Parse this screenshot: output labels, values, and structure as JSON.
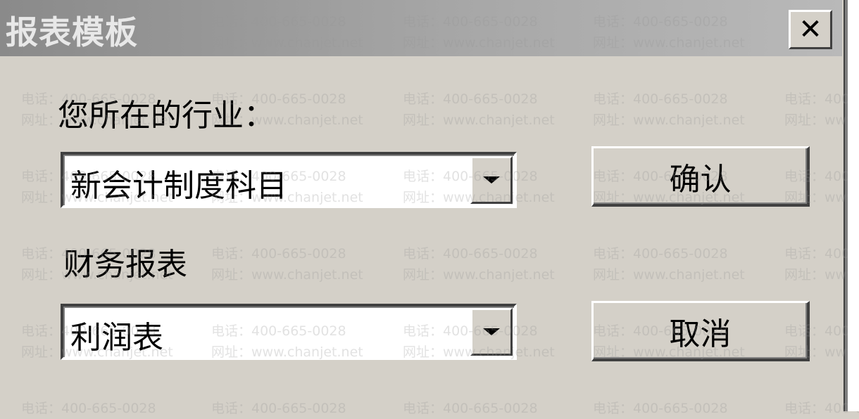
{
  "window": {
    "title": "报表模板",
    "close_label": "✕"
  },
  "industry": {
    "label": "您所在的行业：",
    "selected": "新会计制度科目"
  },
  "report": {
    "label": "财务报表",
    "selected": "利润表"
  },
  "buttons": {
    "confirm": "确认",
    "cancel": "取消"
  },
  "watermark": {
    "phone": "电话：400-665-0028",
    "website": "网址：www.chanjet.net"
  }
}
